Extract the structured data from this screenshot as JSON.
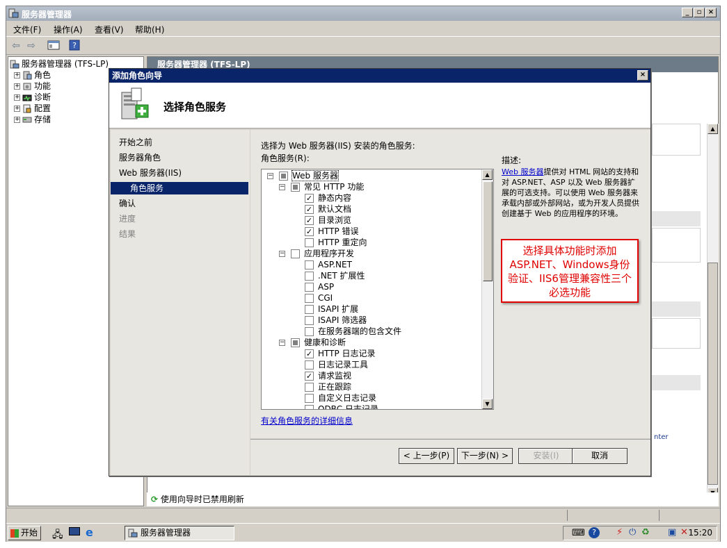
{
  "main_window": {
    "title": "服务器管理器",
    "window_buttons": [
      "_",
      "▫",
      "×"
    ]
  },
  "menu": {
    "items": [
      "文件(F)",
      "操作(A)",
      "查看(V)",
      "帮助(H)"
    ]
  },
  "tree": {
    "root": "服务器管理器 (TFS-LP)",
    "items": [
      "角色",
      "功能",
      "诊断",
      "配置",
      "存储"
    ]
  },
  "right_pane": {
    "header": "服务器管理器 (TFS-LP)",
    "fragment_text": "nter",
    "refresh_status": "使用向导时已禁用刷新"
  },
  "dialog": {
    "title": "添加角色向导",
    "close": "×",
    "banner_title": "选择角色服务",
    "nav": [
      "开始之前",
      "服务器角色",
      "Web 服务器(IIS)",
      "角色服务",
      "确认",
      "进度",
      "结果"
    ],
    "nav_active_index": 3,
    "instruction": "选择为 Web 服务器(IIS) 安装的角色服务:",
    "list_label": "角色服务(R):",
    "description_label": "描述:",
    "description_link": "Web 服务器",
    "description_text": "提供对 HTML 网站的支持和对 ASP.NET、ASP 以及 Web 服务器扩展的可选支持。可以使用 Web 服务器来承载内部或外部网站，或为开发人员提供创建基于 Web 的应用程序的环境。",
    "more_info_link": "有关角色服务的详细信息",
    "buttons": {
      "prev": "< 上一步(P)",
      "next": "下一步(N) >",
      "install": "安装(I)",
      "cancel": "取消"
    },
    "role_services": [
      {
        "label": "Web 服务器",
        "level": 0,
        "state": "partial",
        "expander": "−"
      },
      {
        "label": "常见 HTTP 功能",
        "level": 1,
        "state": "partial",
        "expander": "−"
      },
      {
        "label": "静态内容",
        "level": 2,
        "state": "checked"
      },
      {
        "label": "默认文档",
        "level": 2,
        "state": "checked"
      },
      {
        "label": "目录浏览",
        "level": 2,
        "state": "checked"
      },
      {
        "label": "HTTP 错误",
        "level": 2,
        "state": "checked"
      },
      {
        "label": "HTTP 重定向",
        "level": 2,
        "state": "unchecked"
      },
      {
        "label": "应用程序开发",
        "level": 1,
        "state": "unchecked",
        "expander": "−"
      },
      {
        "label": "ASP.NET",
        "level": 2,
        "state": "unchecked"
      },
      {
        "label": ".NET 扩展性",
        "level": 2,
        "state": "unchecked"
      },
      {
        "label": "ASP",
        "level": 2,
        "state": "unchecked"
      },
      {
        "label": "CGI",
        "level": 2,
        "state": "unchecked"
      },
      {
        "label": "ISAPI 扩展",
        "level": 2,
        "state": "unchecked"
      },
      {
        "label": "ISAPI 筛选器",
        "level": 2,
        "state": "unchecked"
      },
      {
        "label": "在服务器端的包含文件",
        "level": 2,
        "state": "unchecked"
      },
      {
        "label": "健康和诊断",
        "level": 1,
        "state": "partial",
        "expander": "−"
      },
      {
        "label": "HTTP 日志记录",
        "level": 2,
        "state": "checked"
      },
      {
        "label": "日志记录工具",
        "level": 2,
        "state": "unchecked"
      },
      {
        "label": "请求监视",
        "level": 2,
        "state": "checked"
      },
      {
        "label": "正在跟踪",
        "level": 2,
        "state": "unchecked"
      },
      {
        "label": "自定义日志记录",
        "level": 2,
        "state": "unchecked"
      },
      {
        "label": "ODBC 日志记录",
        "level": 2,
        "state": "unchecked"
      }
    ]
  },
  "annotation": "选择具体功能时添加ASP.NET、Windows身份验证、IIS6管理兼容性三个必选功能",
  "taskbar": {
    "start": "开始",
    "task_item": "服务器管理器",
    "clock": "15:20"
  },
  "colors": {
    "dialog_title": "#0a246a",
    "annotation": "#e00000",
    "link": "#0000cc"
  }
}
